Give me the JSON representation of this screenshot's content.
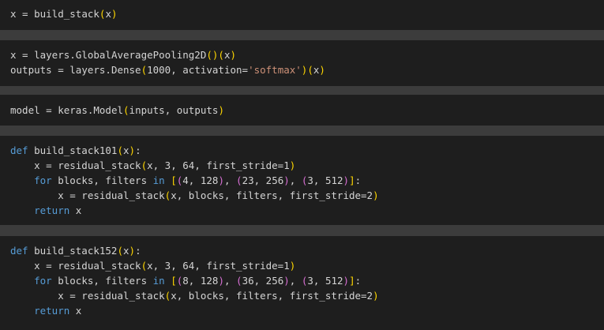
{
  "cells": [
    {
      "lines": [
        [
          [
            "x",
            "txt"
          ],
          [
            " = ",
            "txt"
          ],
          [
            "build_stack",
            "txt"
          ],
          [
            "(",
            "paren1"
          ],
          [
            "x",
            "txt"
          ],
          [
            ")",
            "paren1"
          ]
        ]
      ]
    },
    {
      "lines": [
        [
          [
            "x",
            "txt"
          ],
          [
            " = ",
            "txt"
          ],
          [
            "layers.GlobalAveragePooling2D",
            "txt"
          ],
          [
            "()",
            "paren1"
          ],
          [
            "(",
            "paren1"
          ],
          [
            "x",
            "txt"
          ],
          [
            ")",
            "paren1"
          ]
        ],
        [
          [
            "outputs",
            "txt"
          ],
          [
            " = ",
            "txt"
          ],
          [
            "layers.Dense",
            "txt"
          ],
          [
            "(",
            "paren1"
          ],
          [
            "1000",
            "txt"
          ],
          [
            ", activation=",
            "txt"
          ],
          [
            "'softmax'",
            "str"
          ],
          [
            ")",
            "paren1"
          ],
          [
            "(",
            "paren1"
          ],
          [
            "x",
            "txt"
          ],
          [
            ")",
            "paren1"
          ]
        ]
      ]
    },
    {
      "lines": [
        [
          [
            "model",
            "txt"
          ],
          [
            " = ",
            "txt"
          ],
          [
            "keras.Model",
            "txt"
          ],
          [
            "(",
            "paren1"
          ],
          [
            "inputs, outputs",
            "txt"
          ],
          [
            ")",
            "paren1"
          ]
        ]
      ]
    },
    {
      "lines": [
        [
          [
            "def",
            "kw"
          ],
          [
            " build_stack101",
            "txt"
          ],
          [
            "(",
            "paren1"
          ],
          [
            "x",
            "txt"
          ],
          [
            ")",
            "paren1"
          ],
          [
            ":",
            "txt"
          ]
        ],
        [
          [
            "    x = residual_stack",
            "txt"
          ],
          [
            "(",
            "paren1"
          ],
          [
            "x, 3, 64, first_stride=1",
            "txt"
          ],
          [
            ")",
            "paren1"
          ]
        ],
        [
          [
            "    ",
            "txt"
          ],
          [
            "for",
            "kw"
          ],
          [
            " blocks, filters ",
            "txt"
          ],
          [
            "in",
            "kw"
          ],
          [
            " ",
            "txt"
          ],
          [
            "[",
            "paren1"
          ],
          [
            "(",
            "paren2"
          ],
          [
            "4, 128",
            "txt"
          ],
          [
            ")",
            "paren2"
          ],
          [
            ", ",
            "txt"
          ],
          [
            "(",
            "paren2"
          ],
          [
            "23, 256",
            "txt"
          ],
          [
            ")",
            "paren2"
          ],
          [
            ", ",
            "txt"
          ],
          [
            "(",
            "paren2"
          ],
          [
            "3, 512",
            "txt"
          ],
          [
            ")",
            "paren2"
          ],
          [
            "]",
            "paren1"
          ],
          [
            ":",
            "txt"
          ]
        ],
        [
          [
            "        x = residual_stack",
            "txt"
          ],
          [
            "(",
            "paren1"
          ],
          [
            "x, blocks, filters, first_stride=2",
            "txt"
          ],
          [
            ")",
            "paren1"
          ]
        ],
        [
          [
            "    ",
            "txt"
          ],
          [
            "return",
            "kw"
          ],
          [
            " x",
            "txt"
          ]
        ]
      ]
    },
    {
      "lines": [
        [
          [
            "def",
            "kw"
          ],
          [
            " build_stack152",
            "txt"
          ],
          [
            "(",
            "paren1"
          ],
          [
            "x",
            "txt"
          ],
          [
            ")",
            "paren1"
          ],
          [
            ":",
            "txt"
          ]
        ],
        [
          [
            "    x = residual_stack",
            "txt"
          ],
          [
            "(",
            "paren1"
          ],
          [
            "x, 3, 64, first_stride=1",
            "txt"
          ],
          [
            ")",
            "paren1"
          ]
        ],
        [
          [
            "    ",
            "txt"
          ],
          [
            "for",
            "kw"
          ],
          [
            " blocks, filters ",
            "txt"
          ],
          [
            "in",
            "kw"
          ],
          [
            " ",
            "txt"
          ],
          [
            "[",
            "paren1"
          ],
          [
            "(",
            "paren2"
          ],
          [
            "8, 128",
            "txt"
          ],
          [
            ")",
            "paren2"
          ],
          [
            ", ",
            "txt"
          ],
          [
            "(",
            "paren2"
          ],
          [
            "36, 256",
            "txt"
          ],
          [
            ")",
            "paren2"
          ],
          [
            ", ",
            "txt"
          ],
          [
            "(",
            "paren2"
          ],
          [
            "3, 512",
            "txt"
          ],
          [
            ")",
            "paren2"
          ],
          [
            "]",
            "paren1"
          ],
          [
            ":",
            "txt"
          ]
        ],
        [
          [
            "        x = residual_stack",
            "txt"
          ],
          [
            "(",
            "paren1"
          ],
          [
            "x, blocks, filters, first_stride=2",
            "txt"
          ],
          [
            ")",
            "paren1"
          ]
        ],
        [
          [
            "    ",
            "txt"
          ],
          [
            "return",
            "kw"
          ],
          [
            " x",
            "txt"
          ]
        ]
      ]
    }
  ]
}
